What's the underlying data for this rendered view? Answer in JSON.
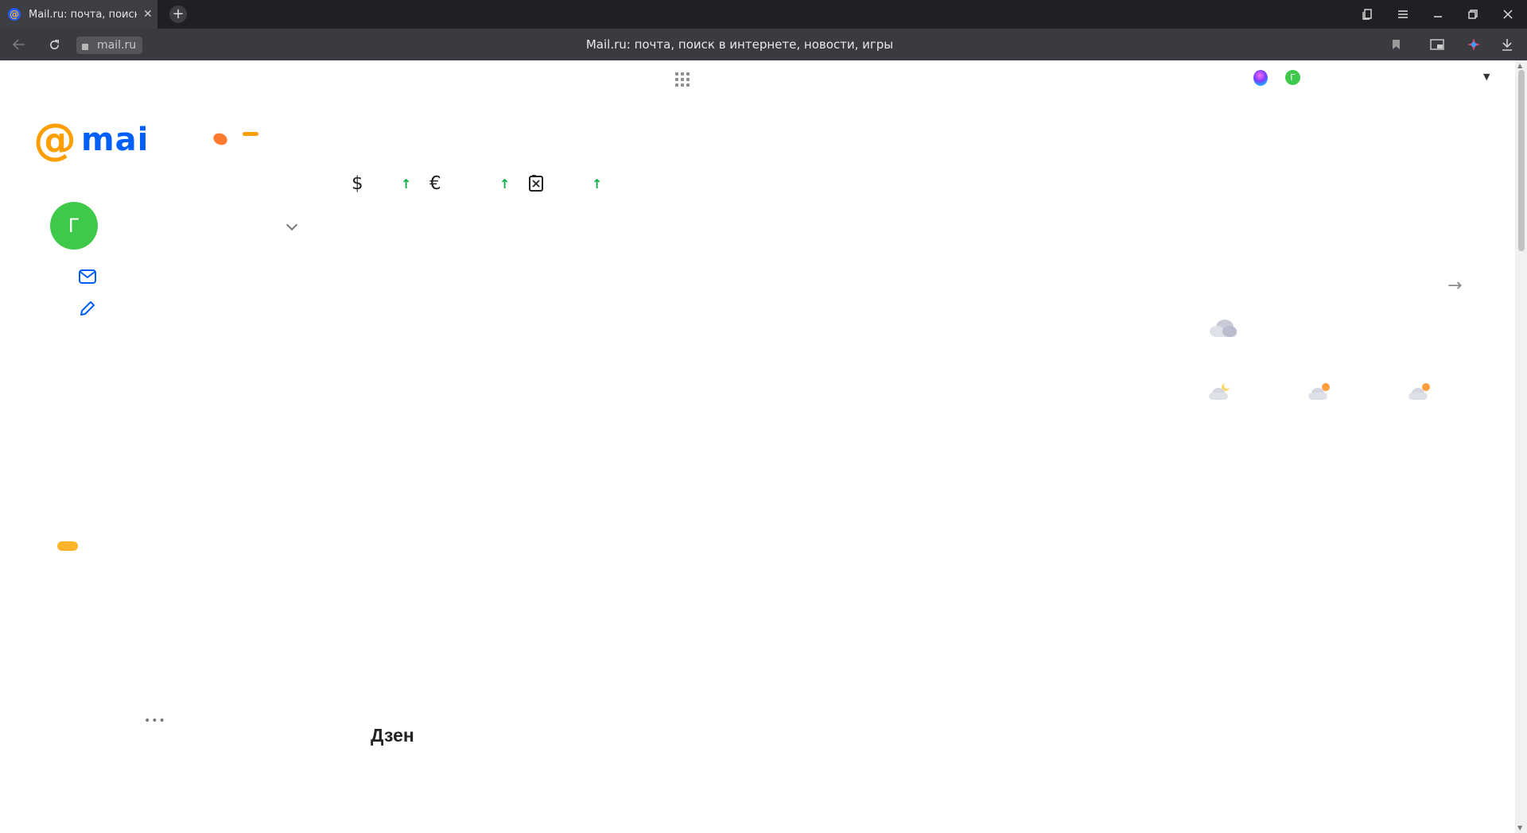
{
  "browser": {
    "tab_title": "Mail.ru: почта, поиск в и",
    "tab_close": "✕",
    "favicon_glyph": "@",
    "new_tab": "+",
    "url": "mail.ru",
    "page_title": "Mail.ru: почта, поиск в интернете, новости, игры"
  },
  "window_controls": [
    "bookmarks-panel-icon",
    "menu-icon",
    "minimize-icon",
    "restore-icon",
    "close-icon"
  ],
  "header": {
    "user_initial_small": "Г"
  },
  "logo": {
    "at": "@",
    "word": "mai"
  },
  "rates": {
    "usd_icon": "$",
    "eur_icon": "€",
    "oil_icon": "⛽",
    "up_arrow": "↑"
  },
  "account": {
    "initial": "Г"
  },
  "weather": {
    "arrow": "→"
  },
  "feed": {
    "more": "•••",
    "title": "Дзен"
  },
  "colors": {
    "brand_orange": "#ff9e00",
    "brand_blue": "#005ff9",
    "avatar_green": "#3fc94b",
    "up_green": "#12b04c"
  }
}
